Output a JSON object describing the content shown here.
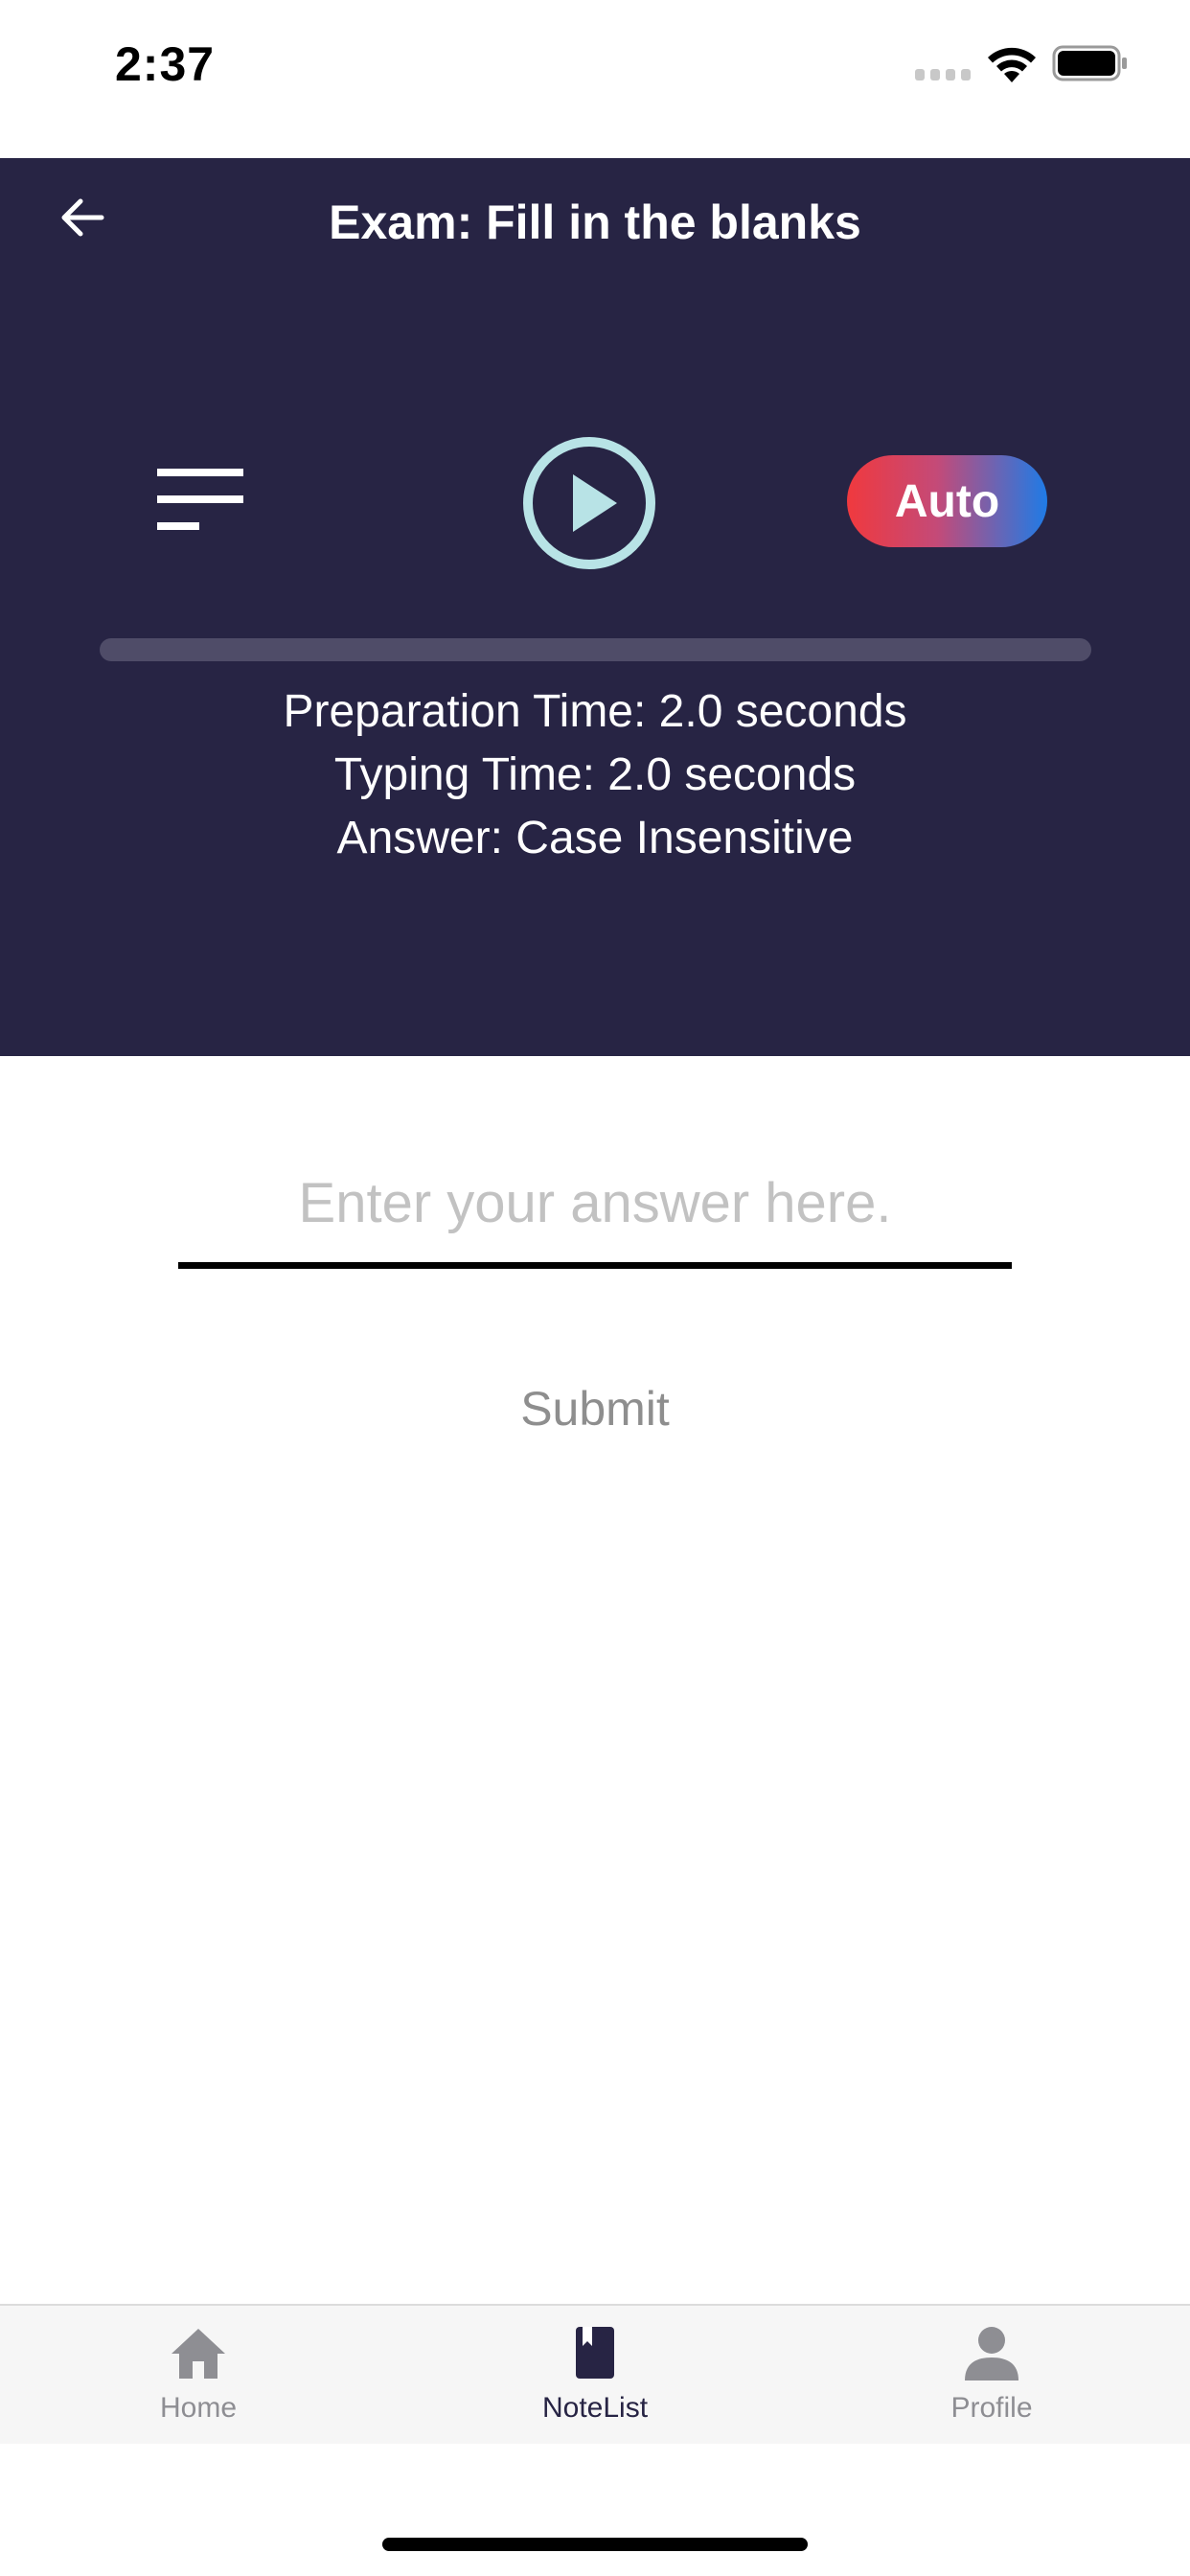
{
  "status_bar": {
    "time": "2:37",
    "signal_icon": "signal-dots-icon",
    "wifi_icon": "wifi-icon",
    "battery_icon": "battery-icon"
  },
  "header": {
    "title": "Exam: Fill in the blanks",
    "back_icon": "arrow-left-icon",
    "background_color": "#272444"
  },
  "controls": {
    "list_icon": "list-icon",
    "play_icon": "play-circle-icon",
    "play_color": "#b8e3e6",
    "auto_label": "Auto",
    "auto_gradient": [
      "#f0393e",
      "#1f7be6"
    ]
  },
  "progress": {
    "fraction": 0
  },
  "info": {
    "preparation": "Preparation Time: 2.0 seconds",
    "typing": "Typing Time: 2.0 seconds",
    "answer_mode": "Answer: Case Insensitive"
  },
  "answer": {
    "placeholder": "Enter your answer here.",
    "value": "",
    "submit_label": "Submit"
  },
  "tabs": [
    {
      "label": "Home",
      "icon": "home-icon",
      "active": false
    },
    {
      "label": "NoteList",
      "icon": "book-icon",
      "active": true
    },
    {
      "label": "Profile",
      "icon": "person-icon",
      "active": false
    }
  ]
}
